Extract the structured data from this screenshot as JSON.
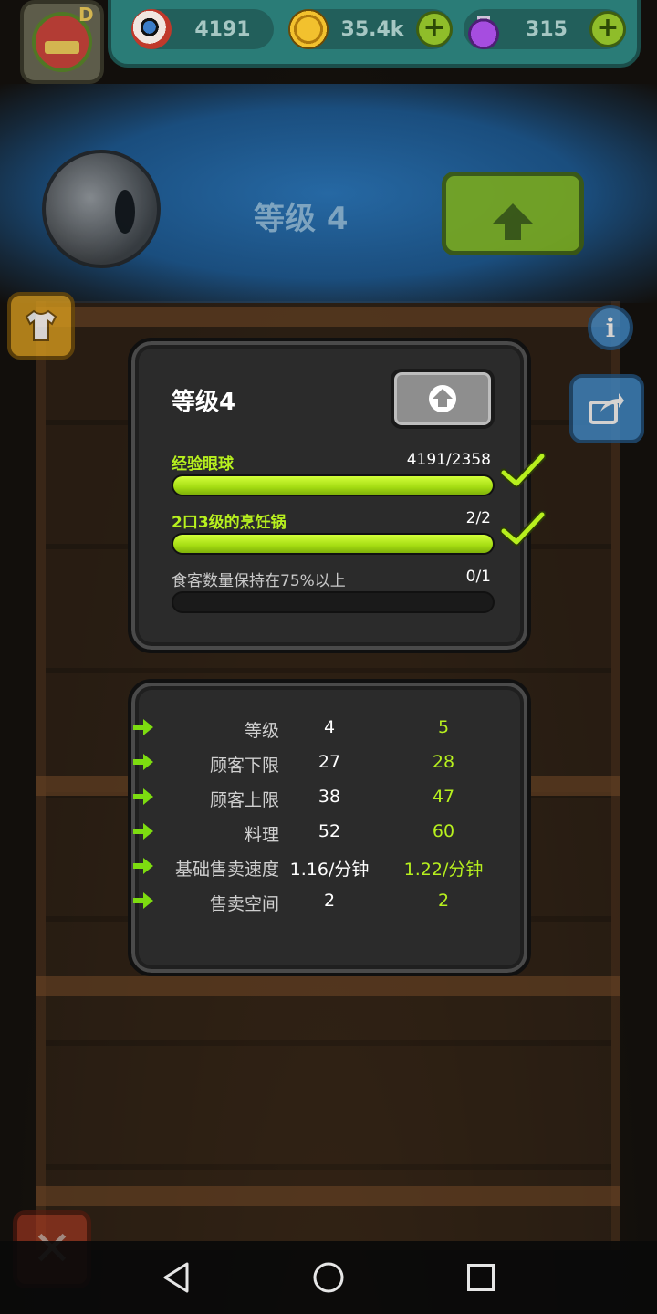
{
  "resources": {
    "eyeballs": "4191",
    "coins": "35.4k",
    "potions": "315"
  },
  "avatar": {
    "rank_letter": "D"
  },
  "banner": {
    "level_text": "等级 4"
  },
  "requirements_panel": {
    "title": "等级4",
    "requirements": [
      {
        "label": "经验眼球",
        "progress_text": "4191/2358",
        "fill": 1.0,
        "completed": true
      },
      {
        "label": "2口3级的烹饪锅",
        "progress_text": "2/2",
        "fill": 1.0,
        "completed": true
      },
      {
        "label": "食客数量保持在75%以上",
        "progress_text": "0/1",
        "fill": 0.0,
        "completed": false
      }
    ]
  },
  "stats_panel": {
    "rows": [
      {
        "name": "等级",
        "current": "4",
        "next": "5"
      },
      {
        "name": "顾客下限",
        "current": "27",
        "next": "28"
      },
      {
        "name": "顾客上限",
        "current": "38",
        "next": "47"
      },
      {
        "name": "料理",
        "current": "52",
        "next": "60"
      },
      {
        "name": "基础售卖速度",
        "current": "1.16/分钟",
        "next": "1.22/分钟"
      },
      {
        "name": "售卖空间",
        "current": "2",
        "next": "2"
      }
    ]
  },
  "colors": {
    "accent_green": "#b7f01e",
    "panel_bg": "#2b2b2b",
    "upgrade_green": "#7fae17",
    "info_blue": "#3f87c4"
  },
  "icons": {
    "eyeball": "eyeball-icon",
    "coin": "coin-icon",
    "potion": "potion-icon",
    "plus": "plus-icon",
    "upload": "upload-arrow-icon",
    "check": "checkmark-icon",
    "arrow": "right-arrow-icon",
    "shirt": "shirt-icon",
    "info": "info-icon",
    "share": "share-icon",
    "close": "close-icon"
  }
}
